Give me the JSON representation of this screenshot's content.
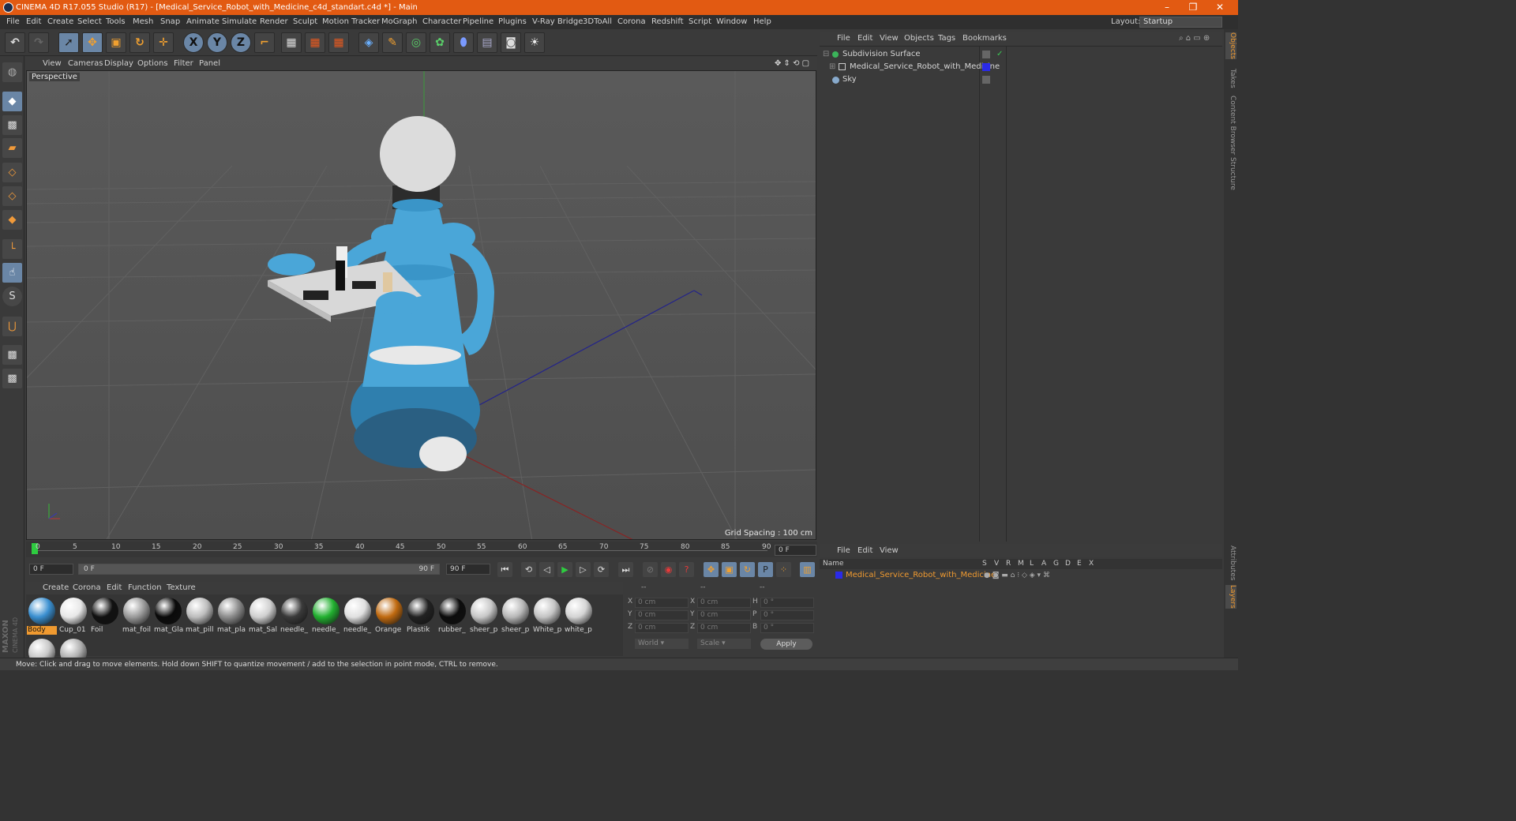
{
  "window": {
    "title": "CINEMA 4D R17.055 Studio (R17) - [Medical_Service_Robot_with_Medicine_c4d_standart.c4d *] - Main",
    "controls": [
      "–",
      "❐",
      "✕"
    ]
  },
  "menubar": {
    "items": [
      "File",
      "Edit",
      "Create",
      "Select",
      "Tools",
      "Mesh",
      "Snap",
      "Animate",
      "Simulate",
      "Render",
      "Sculpt",
      "Motion Tracker",
      "MoGraph",
      "Character",
      "Pipeline",
      "Plugins",
      "V-Ray Bridge",
      "3DToAll",
      "Corona",
      "Redshift",
      "Script",
      "Window",
      "Help"
    ],
    "layout_label": "Layout:",
    "layout_value": "Startup"
  },
  "toolbar": {
    "axis_x": "X",
    "axis_y": "Y",
    "axis_z": "Z"
  },
  "viewport": {
    "menu": [
      "View",
      "Cameras",
      "Display",
      "Options",
      "Filter",
      "Panel"
    ],
    "label": "Perspective",
    "grid_spacing": "Grid Spacing : 100 cm"
  },
  "timeline": {
    "ticks": [
      "0",
      "5",
      "10",
      "15",
      "20",
      "25",
      "30",
      "35",
      "40",
      "45",
      "50",
      "55",
      "60",
      "65",
      "70",
      "75",
      "80",
      "85",
      "90"
    ],
    "current_frame": "0 F",
    "start_field": "0 F",
    "range_start": "0 F",
    "range_end": "90 F",
    "end_field": "90 F"
  },
  "materials": {
    "menu": [
      "Create",
      "Corona",
      "Edit",
      "Function",
      "Texture"
    ],
    "items": [
      {
        "name": "Body",
        "color": "#3a8fd0"
      },
      {
        "name": "Cup_01",
        "color": "#e8e8e8"
      },
      {
        "name": "Foil",
        "color": "#111111"
      },
      {
        "name": "mat_foil",
        "color": "#9a9a9a"
      },
      {
        "name": "mat_Gla",
        "color": "#0a0a0a"
      },
      {
        "name": "mat_pill",
        "color": "#bdbdbd"
      },
      {
        "name": "mat_pla",
        "color": "#8c8c8c"
      },
      {
        "name": "mat_Sal",
        "color": "#d0d0d0"
      },
      {
        "name": "needle_",
        "color": "#3a3a3a"
      },
      {
        "name": "needle_",
        "color": "#22b030"
      },
      {
        "name": "needle_",
        "color": "#e0e0e0"
      },
      {
        "name": "Orange",
        "color": "#c06a10"
      },
      {
        "name": "Plastik",
        "color": "#222222"
      },
      {
        "name": "rubber_",
        "color": "#0c0c0c"
      },
      {
        "name": "sheer_p",
        "color": "#c8c8c8"
      },
      {
        "name": "sheer_p",
        "color": "#b8b8b8"
      },
      {
        "name": "White_p",
        "color": "#c4c4c4"
      },
      {
        "name": "white_p",
        "color": "#d4d4d4"
      },
      {
        "name": "",
        "color": "#c8c8c8"
      },
      {
        "name": "",
        "color": "#b0b0b0"
      }
    ]
  },
  "coordinates": {
    "header": [
      "--",
      "--",
      "--"
    ],
    "rows": [
      {
        "a": "X",
        "v1": "0 cm",
        "b": "X",
        "v2": "0 cm",
        "c": "H",
        "v3": "0 °"
      },
      {
        "a": "Y",
        "v1": "0 cm",
        "b": "Y",
        "v2": "0 cm",
        "c": "P",
        "v3": "0 °"
      },
      {
        "a": "Z",
        "v1": "0 cm",
        "b": "Z",
        "v2": "0 cm",
        "c": "B",
        "v3": "0 °"
      }
    ],
    "world": "World",
    "scale": "Scale",
    "apply": "Apply"
  },
  "object_manager": {
    "menu": [
      "File",
      "Edit",
      "View",
      "Objects",
      "Tags",
      "Bookmarks"
    ],
    "objects": [
      {
        "name": "Subdivision Surface",
        "icon_color": "#3bb35a"
      },
      {
        "name": "Medical_Service_Robot_with_Medicine",
        "icon_color": "#c8c8c8",
        "tag_color": "#2a2ae8"
      },
      {
        "name": "Sky",
        "icon_color": "#88aacc"
      }
    ]
  },
  "layers": {
    "menu": [
      "File",
      "Edit",
      "View"
    ],
    "columns": [
      "Name",
      "S",
      "V",
      "R",
      "M",
      "L",
      "A",
      "G",
      "D",
      "E",
      "X"
    ],
    "rows": [
      {
        "name": "Medical_Service_Robot_with_Medicine",
        "color": "#2a2ae8"
      }
    ]
  },
  "right_tabs": [
    "Objects",
    "Takes",
    "Content Browser",
    "Structure",
    "Attributes",
    "Layers"
  ],
  "status": "Move: Click and drag to move elements. Hold down SHIFT to quantize movement / add to the selection in point mode, CTRL to remove.",
  "brand": [
    "MAXON",
    "CINEMA 4D"
  ]
}
